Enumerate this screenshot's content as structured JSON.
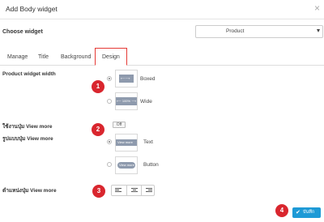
{
  "dialog": {
    "title": "Add Body widget",
    "close_label": "×"
  },
  "choose_widget": {
    "label": "Choose widget",
    "selected": "Product"
  },
  "tabs": [
    {
      "label": "Manage"
    },
    {
      "label": "Title"
    },
    {
      "label": "Background"
    },
    {
      "label": "Design",
      "active": true
    }
  ],
  "product_width": {
    "label": "Product widget width",
    "options": [
      {
        "label": "Boxed",
        "thumb_text": "⟵⟶",
        "checked": true
      },
      {
        "label": "Wide",
        "thumb_text": "⟵ 100% ⟶",
        "checked": false
      }
    ]
  },
  "view_more_toggle": {
    "label": "ใช้งานปุ่ม View more",
    "value": "Off"
  },
  "view_more_style": {
    "label": "รูปแบบปุ่ม View more",
    "options": [
      {
        "label": "Text",
        "thumb_text": "View more",
        "checked": true
      },
      {
        "label": "Button",
        "thumb_text": "View more",
        "checked": false
      }
    ]
  },
  "view_more_position": {
    "label": "ตำแหน่งปุ่ม View more",
    "options": [
      "left",
      "center",
      "right"
    ]
  },
  "step_badges": [
    "1",
    "2",
    "3",
    "4"
  ],
  "save": {
    "label": "บันทึก",
    "icon": "check-icon"
  },
  "colors": {
    "accent": "#1e9ad6",
    "badge": "#d9262e",
    "tab_highlight": "#e53935",
    "thumb": "#8e9aad"
  }
}
